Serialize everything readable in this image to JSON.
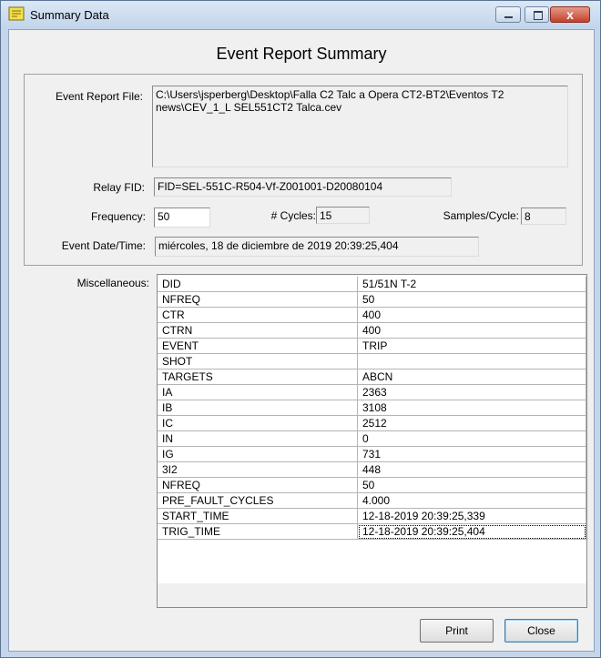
{
  "window": {
    "title": "Summary Data",
    "close_glyph": "x"
  },
  "heading": "Event Report Summary",
  "fields": {
    "event_report_file_label": "Event Report File:",
    "event_report_file": "C:\\Users\\jsperberg\\Desktop\\Falla C2 Talc a Opera CT2-BT2\\Eventos T2 news\\CEV_1_L SEL551CT2 Talca.cev",
    "relay_fid_label": "Relay FID:",
    "relay_fid": "FID=SEL-551C-R504-Vf-Z001001-D20080104",
    "frequency_label": "Frequency:",
    "frequency": "50",
    "cycles_label": "# Cycles:",
    "cycles": "15",
    "samples_per_cycle_label": "Samples/Cycle:",
    "samples_per_cycle": "8",
    "event_datetime_label": "Event Date/Time:",
    "event_datetime": "miércoles, 18 de diciembre de 2019  20:39:25,404"
  },
  "misc": {
    "label": "Miscellaneous:",
    "rows": [
      {
        "key": "DID",
        "value": "51/51N T-2"
      },
      {
        "key": "NFREQ",
        "value": "50"
      },
      {
        "key": "CTR",
        "value": "400"
      },
      {
        "key": "CTRN",
        "value": "400"
      },
      {
        "key": "EVENT",
        "value": "TRIP"
      },
      {
        "key": "SHOT",
        "value": ""
      },
      {
        "key": "TARGETS",
        "value": "ABCN"
      },
      {
        "key": "IA",
        "value": "2363"
      },
      {
        "key": "IB",
        "value": "3108"
      },
      {
        "key": "IC",
        "value": "2512"
      },
      {
        "key": "IN",
        "value": "0"
      },
      {
        "key": "IG",
        "value": "731"
      },
      {
        "key": "3I2",
        "value": "448"
      },
      {
        "key": "NFREQ",
        "value": "50"
      },
      {
        "key": "PRE_FAULT_CYCLES",
        "value": "4.000"
      },
      {
        "key": "START_TIME",
        "value": "12-18-2019 20:39:25,339"
      },
      {
        "key": "TRIG_TIME",
        "value": "12-18-2019 20:39:25,404"
      }
    ]
  },
  "buttons": {
    "print": "Print",
    "close": "Close"
  },
  "colors": {
    "title_bar": "#c2d5ec",
    "close_button": "#c4412c",
    "app_icon": "#f5e04a"
  }
}
